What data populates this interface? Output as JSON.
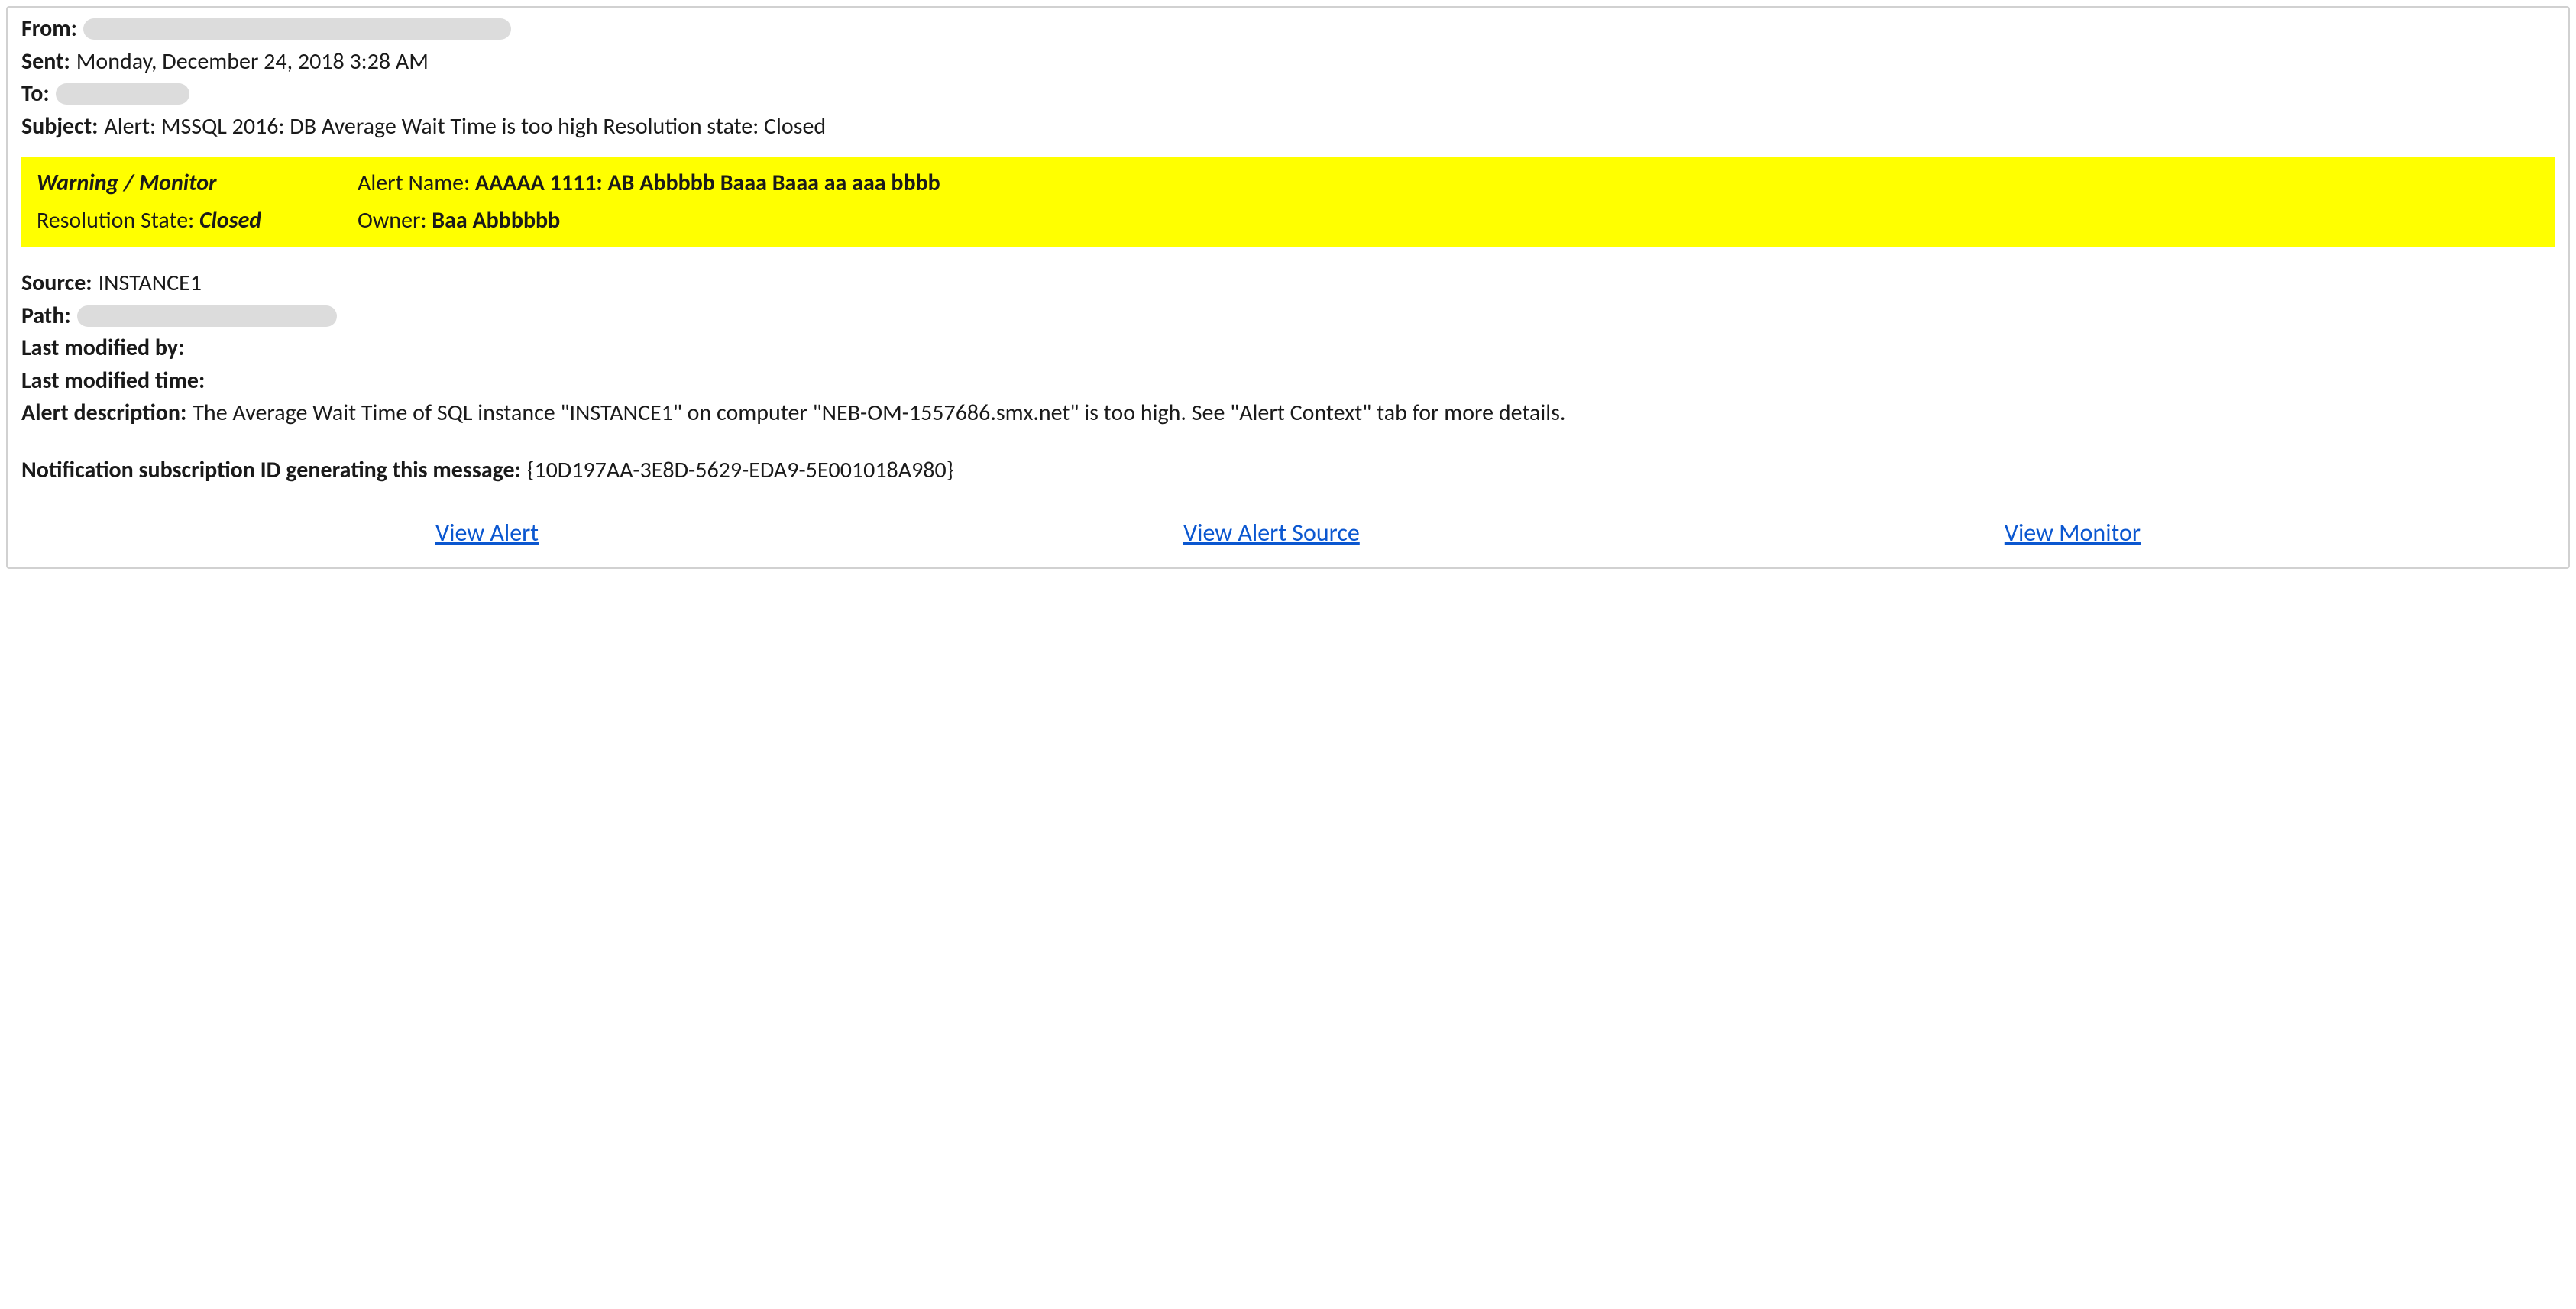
{
  "header": {
    "from_label": "From:",
    "sent_label": "Sent:",
    "sent_value": "Monday, December 24, 2018 3:28 AM",
    "to_label": "To:",
    "subject_label": "Subject:",
    "subject_value": "Alert: MSSQL 2016: DB Average Wait Time is too high Resolution state: Closed"
  },
  "banner": {
    "warning_label": "Warning / Monitor",
    "resolution_label": "Resolution State: ",
    "resolution_value": "Closed",
    "alert_name_label": "Alert Name:  ",
    "alert_name_value": "AAAAA 1111: AB Abbbbb Baaa Baaa aa aaa bbbb",
    "owner_label": "Owner:  ",
    "owner_value": "Baa Abbbbbb"
  },
  "body": {
    "source_label": "Source:",
    "source_value": "INSTANCE1",
    "path_label": "Path:",
    "last_modified_by_label": "Last modified by:",
    "last_modified_by_value": "",
    "last_modified_time_label": "Last modified time:",
    "last_modified_time_value": "",
    "alert_desc_label": "Alert description:",
    "alert_desc_value": "The Average Wait Time of SQL instance \"INSTANCE1\" on computer \"NEB-OM-1557686.smx.net\" is too high. See \"Alert Context\" tab for more details.",
    "sub_id_label": "Notification subscription ID generating this message:",
    "sub_id_value": "{10D197AA-3E8D-5629-EDA9-5E001018A980}"
  },
  "links": {
    "view_alert": "View Alert",
    "view_alert_source": "View Alert Source",
    "view_monitor": "View Monitor"
  }
}
